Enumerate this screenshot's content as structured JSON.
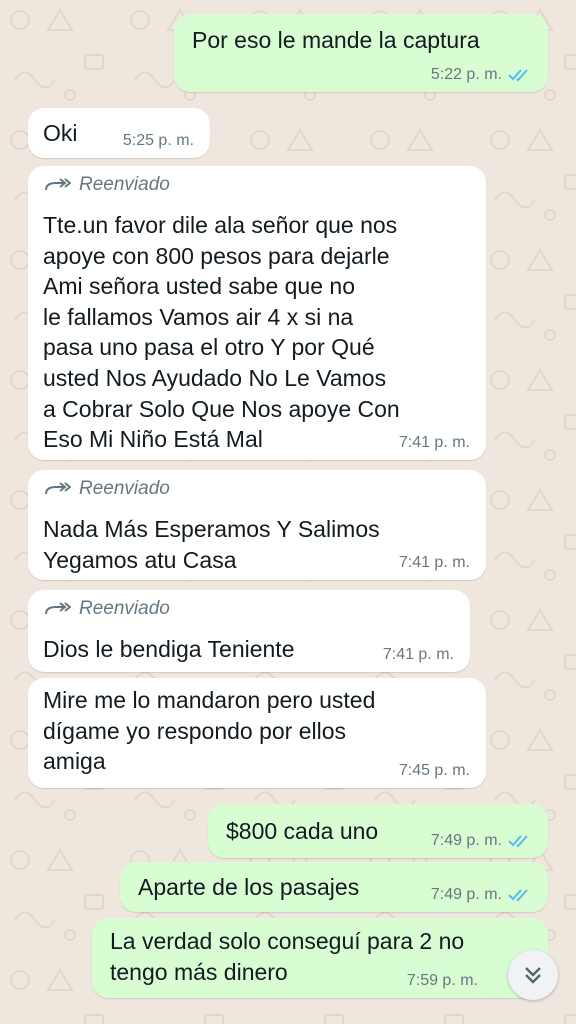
{
  "colors": {
    "background": "#efe7de",
    "incoming_bubble": "#ffffff",
    "outgoing_bubble": "#d9fdd3",
    "meta_text": "#667781",
    "read_ticks": "#53bdeb"
  },
  "icons": {
    "forwarded": "forward-arrow-icon",
    "read_status": "double-check-icon",
    "scroll_down": "chevron-double-down-icon"
  },
  "messages": [
    {
      "direction": "out",
      "text": "Por eso le mande la captura",
      "time": "5:22 p. m.",
      "read": true
    },
    {
      "direction": "in",
      "text": "Oki",
      "time": "5:25 p. m."
    },
    {
      "direction": "in",
      "forwarded_label": "Reenviado",
      "text": "Tte.un favor dile ala señor que nos\napoye con 800 pesos para dejarle\nAmi señora usted sabe que no\nle fallamos Vamos air 4 x si na\npasa uno pasa el otro Y por Qué\nusted Nos Ayudado No Le Vamos\na Cobrar Solo Que Nos apoye Con\nEso Mi Niño Está Mal",
      "time": "7:41 p. m."
    },
    {
      "direction": "in",
      "forwarded_label": "Reenviado",
      "text": "Nada Más Esperamos Y Salimos\nYegamos atu Casa",
      "time": "7:41 p. m."
    },
    {
      "direction": "in",
      "forwarded_label": "Reenviado",
      "text": "Dios le bendiga Teniente",
      "time": "7:41 p. m."
    },
    {
      "direction": "in",
      "text": "Mire me lo mandaron pero usted\ndígame yo respondo por ellos\namiga",
      "time": "7:45 p. m."
    },
    {
      "direction": "out",
      "text": "$800 cada uno",
      "time": "7:49 p. m.",
      "read": true
    },
    {
      "direction": "out",
      "text": "Aparte de los pasajes",
      "time": "7:49 p. m.",
      "read": true
    },
    {
      "direction": "out",
      "text": "La verdad solo conseguí para 2 no\ntengo más dinero",
      "time": "7:59 p. m.",
      "read": false
    }
  ]
}
